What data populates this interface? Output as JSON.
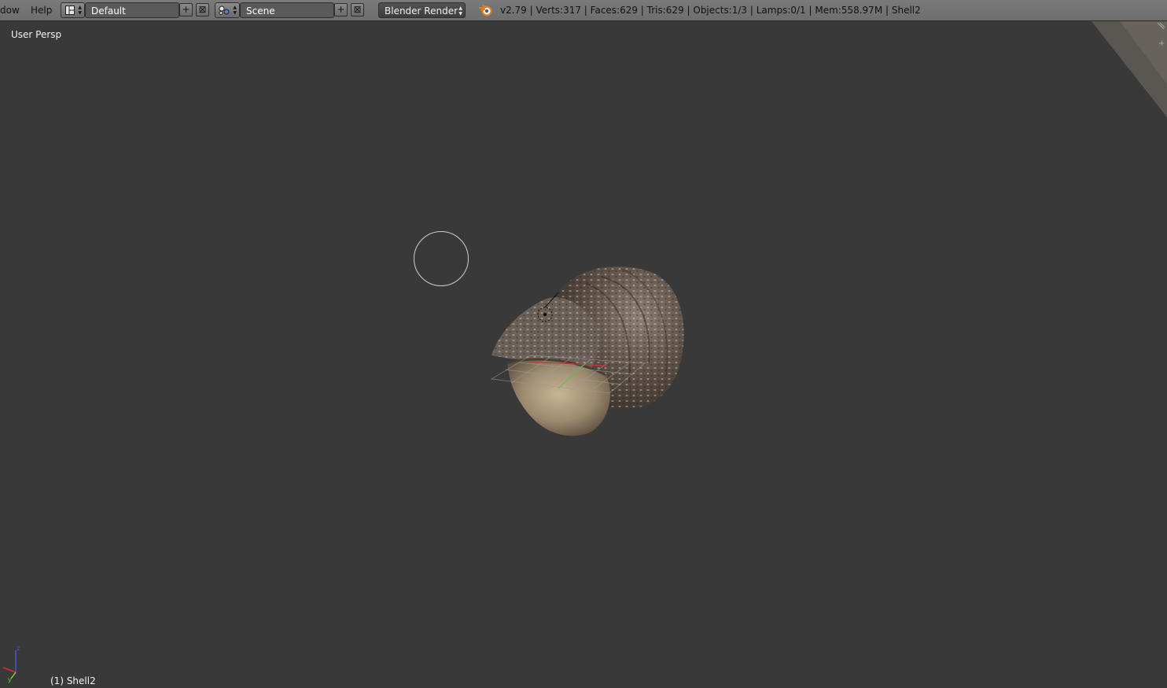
{
  "menu": {
    "window_label": "dow",
    "help_label": "Help"
  },
  "screen_layout": {
    "icon": "layout-icon",
    "value": "Default",
    "add_icon": "plus-icon",
    "remove_icon": "close-icon"
  },
  "scene": {
    "icon": "scene-icon",
    "value": "Scene",
    "add_icon": "plus-icon",
    "remove_icon": "close-icon"
  },
  "render_engine": {
    "value": "Blender Render"
  },
  "info": {
    "logo_icon": "blender-logo-icon",
    "stats": "v2.79 | Verts:317 | Faces:629 | Tris:629 | Objects:1/3 | Lamps:0/1 | Mem:558.97M | Shell2"
  },
  "viewport": {
    "view_name": "User Persp",
    "object_info": "(1) Shell2"
  },
  "colors": {
    "header_bg": "#727272",
    "viewport_bg": "#393939",
    "field_bg": "#5a5a5a",
    "axis_x": "#d43030",
    "axis_y": "#6fd13a",
    "axis_z": "#3a5ad6"
  }
}
